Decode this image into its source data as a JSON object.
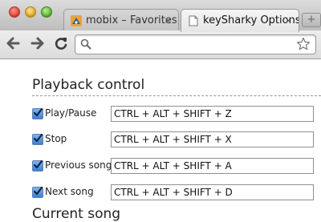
{
  "tabs": [
    {
      "title": "mobix – Favorites",
      "close": "×",
      "active": false,
      "icon": "mobix-favicon"
    },
    {
      "title": "keySharky Options",
      "close": "×",
      "active": true,
      "icon": "page-favicon"
    }
  ],
  "new_tab_label": "+",
  "omnibox": {
    "value": ""
  },
  "sections": {
    "playback_title": "Playback control",
    "current_title": "Current song"
  },
  "shortcuts": [
    {
      "label": "Play/Pause",
      "value": "CTRL + ALT + SHIFT + Z",
      "checked": true
    },
    {
      "label": "Stop",
      "value": "CTRL + ALT + SHIFT + X",
      "checked": true
    },
    {
      "label": "Previous song",
      "value": "CTRL + ALT + SHIFT + A",
      "checked": true
    },
    {
      "label": "Next song",
      "value": "CTRL + ALT + SHIFT + D",
      "checked": true
    }
  ],
  "colors": {
    "checkbox_blue": "#3a7fd6",
    "window_chrome": "#d4d4d4"
  }
}
